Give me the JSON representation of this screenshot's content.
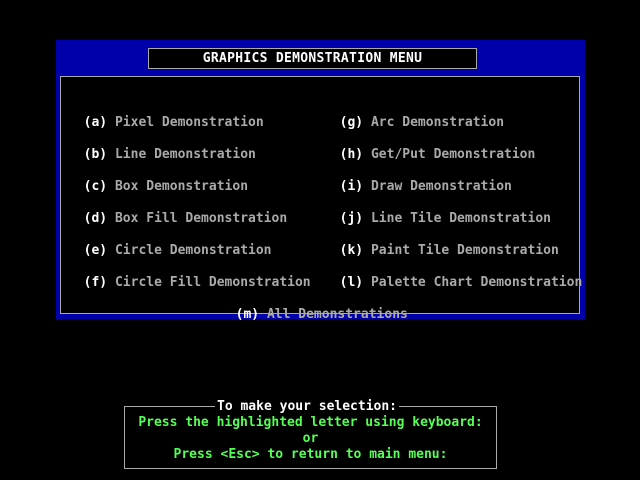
{
  "title": "GRAPHICS DEMONSTRATION MENU",
  "items": [
    {
      "key": "(a)",
      "label": "Pixel Demonstration"
    },
    {
      "key": "(b)",
      "label": "Line Demonstration"
    },
    {
      "key": "(c)",
      "label": "Box Demonstration"
    },
    {
      "key": "(d)",
      "label": "Box Fill Demonstration"
    },
    {
      "key": "(e)",
      "label": "Circle Demonstration"
    },
    {
      "key": "(f)",
      "label": "Circle Fill Demonstration"
    },
    {
      "key": "(g)",
      "label": "Arc Demonstration"
    },
    {
      "key": "(h)",
      "label": "Get/Put Demonstration"
    },
    {
      "key": "(i)",
      "label": "Draw Demonstration"
    },
    {
      "key": "(j)",
      "label": "Line Tile Demonstration"
    },
    {
      "key": "(k)",
      "label": "Paint Tile Demonstration"
    },
    {
      "key": "(l)",
      "label": "Palette Chart Demonstration"
    },
    {
      "key": "(m)",
      "label": "All Demonstrations"
    }
  ],
  "help": {
    "title": "To make your selection:",
    "line1": "Press the highlighted letter using keyboard:",
    "line2": "or",
    "line3": "Press <Esc> to return to main menu:"
  },
  "colors": {
    "panel": "#0000aa",
    "text": "#aaaaaa",
    "key": "#ffffff",
    "help": "#55ff55"
  }
}
